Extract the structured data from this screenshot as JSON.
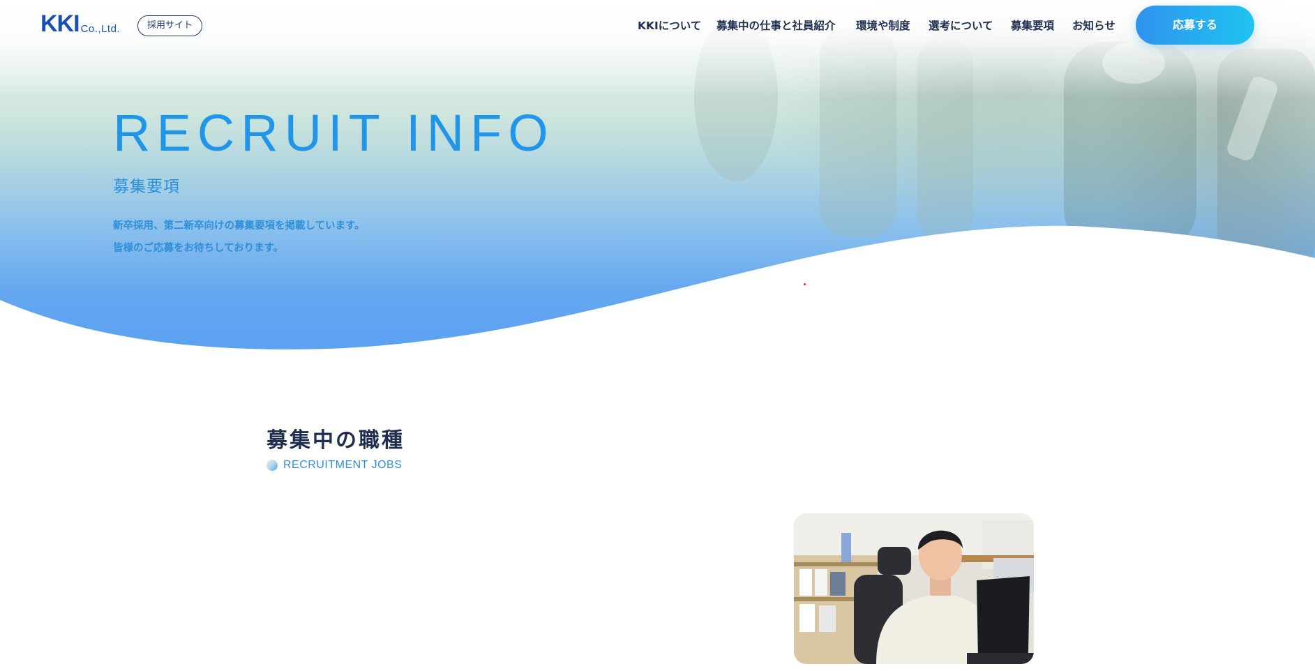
{
  "header": {
    "logo_mark": "KKI",
    "logo_company": "Co.,Ltd.",
    "badge": "採用サイト",
    "nav": [
      {
        "label": "KKIについて"
      },
      {
        "label": "募集中の仕事と社員紹介"
      },
      {
        "label": "環境や制度"
      },
      {
        "label": "選考について"
      },
      {
        "label": "募集要項"
      },
      {
        "label": "お知らせ"
      }
    ],
    "apply_label": "応募する"
  },
  "hero": {
    "title": "RECRUIT INFO",
    "subtitle": "募集要項",
    "line1": "新卒採用、第二新卒向けの募集要項を掲載しています。",
    "line2": "皆様のご応募をお待ちしております。"
  },
  "jobs": {
    "title": "募集中の職種",
    "subtitle": "RECRUITMENT JOBS"
  },
  "colors": {
    "accent": "#2196e8",
    "navy": "#1f2d4f",
    "button_start": "#2f93ef",
    "button_end": "#1fc4f0"
  }
}
